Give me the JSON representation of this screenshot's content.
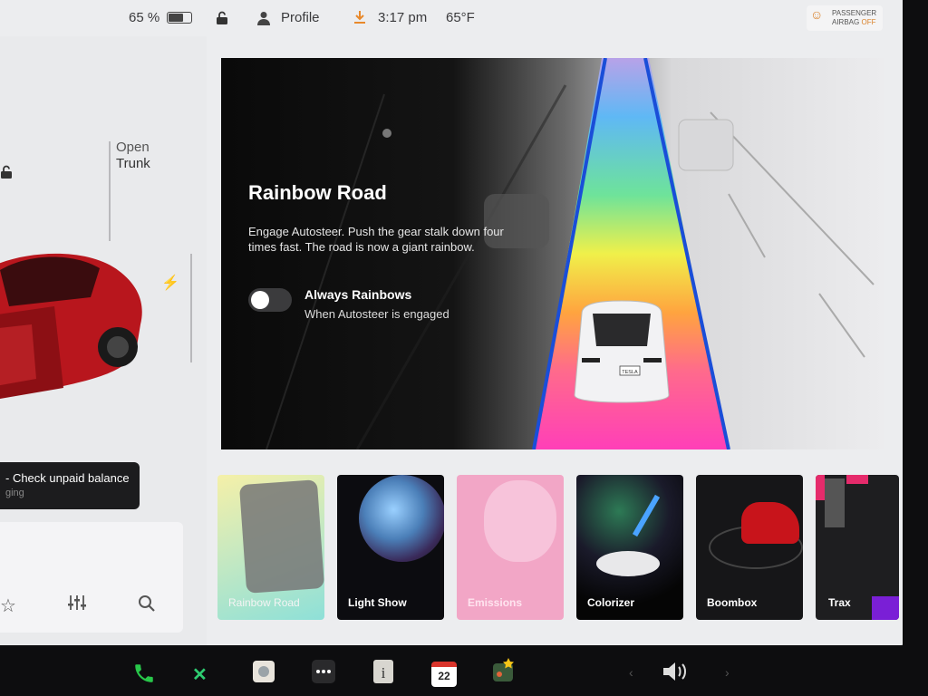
{
  "status_bar": {
    "battery": "65 %",
    "profile": "Profile",
    "time": "3:17 pm",
    "temperature": "65°F",
    "airbag_line1": "PASSENGER",
    "airbag_line2": "AIRBAG",
    "airbag_state": "OFF"
  },
  "left_panel": {
    "open_trunk_1": "Open",
    "open_trunk_2": "Trunk",
    "notice_title": "- Check unpaid balance",
    "notice_sub": "ging"
  },
  "hero": {
    "title": "Rainbow Road",
    "description": "Engage Autosteer. Push the gear stalk down four times fast. The road is now a giant rainbow.",
    "option_label": "Always Rainbows",
    "option_sub": "When Autosteer is engaged",
    "plate": "TESLA"
  },
  "tiles": [
    {
      "label": "Rainbow Road"
    },
    {
      "label": "Light Show"
    },
    {
      "label": "Emissions"
    },
    {
      "label": "Colorizer"
    },
    {
      "label": "Boombox"
    },
    {
      "label": "Trax"
    }
  ],
  "dock": {
    "calendar_day": "22"
  },
  "colors": {
    "rainbow": [
      "#8a52d6",
      "#3fb6ff",
      "#4fe39a",
      "#f2f23a",
      "#ff9a3a",
      "#ff4fb5"
    ],
    "lane": "#1a4ed8"
  },
  "icons": [
    "lock-icon",
    "person-icon",
    "download-icon",
    "airbag-icon",
    "bolt-icon",
    "star-icon",
    "sliders-icon",
    "search-icon",
    "phone-icon",
    "shuffle-icon",
    "toybox-icon",
    "more-icon",
    "manual-icon",
    "calendar-icon",
    "arcade-icon",
    "volume-icon"
  ]
}
